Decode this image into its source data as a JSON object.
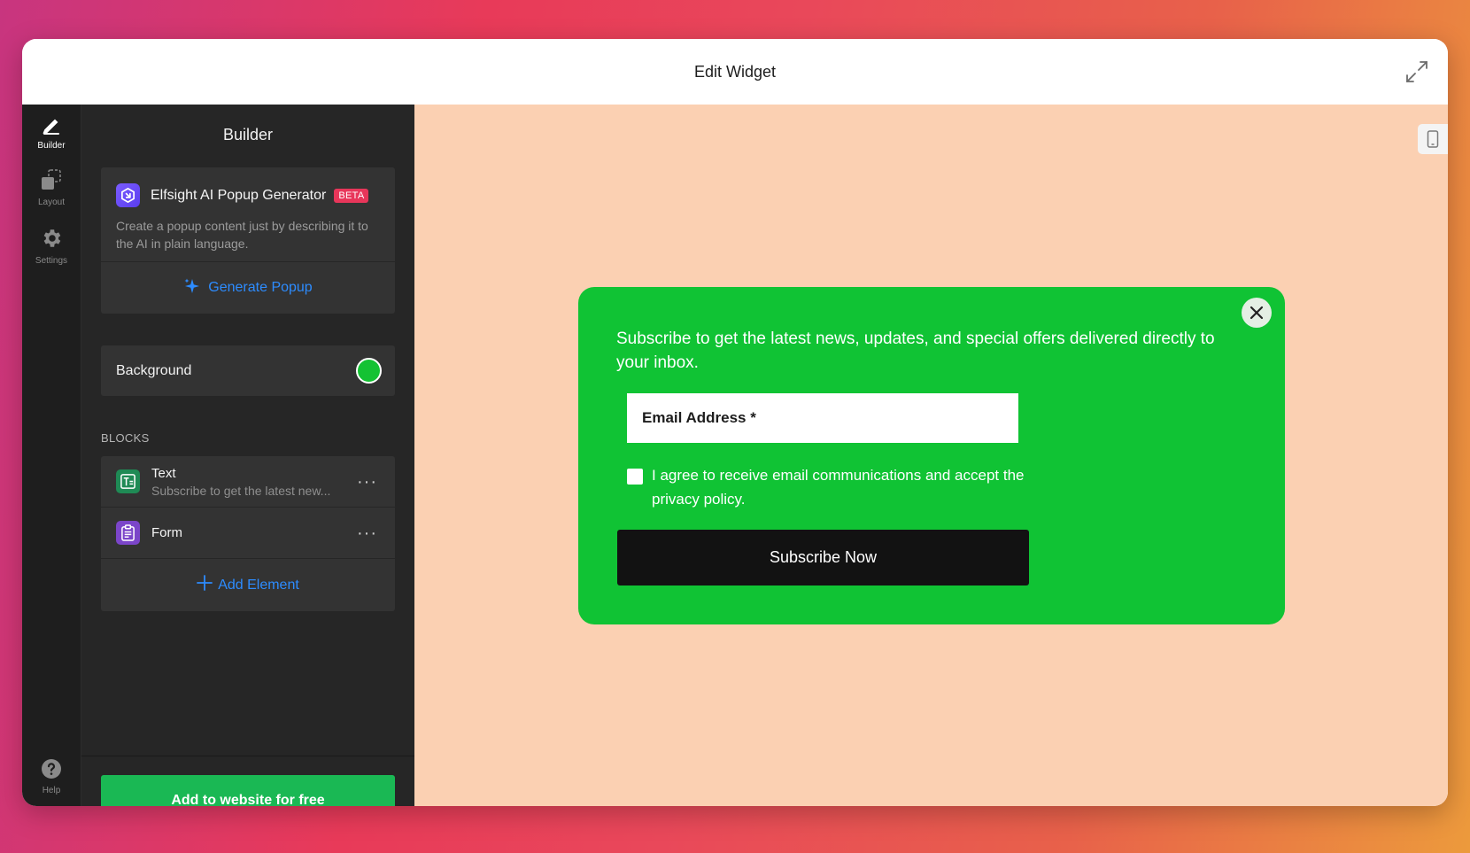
{
  "window": {
    "title": "Edit Widget"
  },
  "rail": {
    "items": [
      {
        "label": "Builder",
        "icon": "pencil-icon"
      },
      {
        "label": "Layout",
        "icon": "layout-icon"
      },
      {
        "label": "Settings",
        "icon": "gear-icon"
      }
    ],
    "help_label": "Help"
  },
  "panel": {
    "title": "Builder",
    "ai": {
      "title": "Elfsight AI Popup Generator",
      "badge": "BETA",
      "description": "Create a popup content just by describing it to the AI in plain language.",
      "generate_label": "Generate Popup"
    },
    "background": {
      "label": "Background",
      "color": "#14c233"
    },
    "blocks_label": "BLOCKS",
    "blocks": [
      {
        "name": "Text",
        "subtitle": "Subscribe to get the latest new..."
      },
      {
        "name": "Form"
      }
    ],
    "add_element_label": "Add Element",
    "cta_label": "Add to website for free"
  },
  "preview": {
    "background_color": "#fbd0b2",
    "popup": {
      "background_color": "#10c334",
      "text": "Subscribe to get the latest news, updates, and special offers delivered directly to your inbox.",
      "email_placeholder": "Email Address *",
      "consent_text": "I agree to receive email communications and accept the privacy policy.",
      "subscribe_label": "Subscribe Now"
    }
  }
}
